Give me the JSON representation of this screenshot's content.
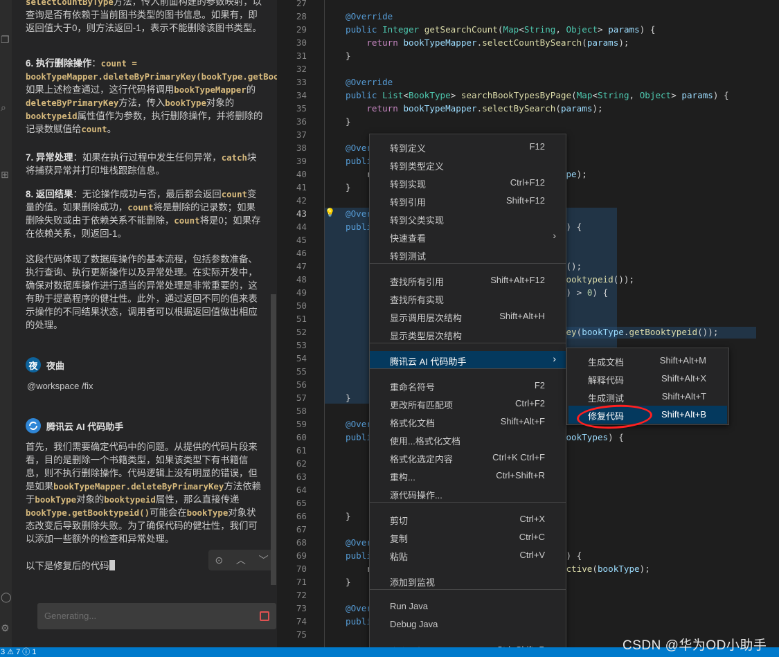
{
  "status_bar": {
    "text": "3 ⚠ 7 ⓘ 1"
  },
  "chat": {
    "paragraphs": [
      {
        "id": "p0",
        "html": "<span class=\"c\">selectCountByType</span>方法，传入前面构建的参数映射，以查询是否有依赖于当前图书类型的图书信息。如果有，即返回值大于0，则方法返回-1，表示不能删除该图书类型。"
      },
      {
        "id": "p1",
        "html": "<b>6. 执行删除操作</b>：<span class=\"c\">count = bookTypeMapper.deleteByPrimaryKey(bookType.getBooktypeid());</span>。如果上述检查通过，这行代码将调用<span class=\"c\">bookTypeMapper</span>的<span class=\"c\">deleteByPrimaryKey</span>方法，传入<span class=\"c\">bookType</span>对象的<span class=\"c\">booktypeid</span>属性值作为参数，执行删除操作，并将删除的记录数赋值给<span class=\"c\">count</span>。"
      },
      {
        "id": "p2",
        "html": "<b>7. 异常处理</b>：如果在执行过程中发生任何异常，<span class=\"c\">catch</span>块将捕获异常并打印堆栈跟踪信息。"
      },
      {
        "id": "p3",
        "html": "<b>8. 返回结果</b>：无论操作成功与否，最后都会返回<span class=\"c\">count</span>变量的值。如果删除成功，<span class=\"c\">count</span>将是删除的记录数；如果删除失败或由于依赖关系不能删除，<span class=\"c\">count</span>将是0；如果存在依赖关系，则返回-1。"
      },
      {
        "id": "p4",
        "html": "这段代码体现了数据库操作的基本流程，包括参数准备、执行查询、执行更新操作以及异常处理。在实际开发中，确保对数据库操作进行适当的异常处理是非常重要的，这有助于提高程序的健壮性。此外，通过返回不同的值来表示操作的不同结果状态，调用者可以根据返回值做出相应的处理。"
      },
      {
        "id": "p5",
        "html": "首先，我们需要确定代码中的问题。从提供的代码片段来看，目的是删除一个书籍类型，如果该类型下有书籍信息，则不执行删除操作。代码逻辑上没有明显的错误，但是如果<span class=\"c\">bookTypeMapper.deleteByPrimaryKey</span>方法依赖于<span class=\"c\">bookType</span>对象的<span class=\"c\">booktypeid</span>属性，那么直接传递<span class=\"c\">bookType.getBooktypeid()</span>可能会在<span class=\"c\">bookType</span>对象状态改变后导致删除失败。为了确保代码的健壮性，我们可以添加一些额外的检查和异常处理。"
      }
    ],
    "user": {
      "avatar": "夜",
      "name": "夜曲",
      "command": "@workspace  /fix"
    },
    "assistant": {
      "name": "腾讯云 AI 代码助手",
      "generating_text": "以下是修复后的代码"
    },
    "input": {
      "placeholder": "Generating..."
    }
  },
  "editor": {
    "line_numbers": [
      "27",
      "28",
      "29",
      "30",
      "31",
      "32",
      "33",
      "34",
      "35",
      "36",
      "37",
      "38",
      "39",
      "40",
      "41",
      "42",
      "43",
      "44",
      "45",
      "46",
      "47",
      "48",
      "49",
      "50",
      "51",
      "52",
      "53",
      "54",
      "55",
      "56",
      "57",
      "58",
      "59",
      "60",
      "61",
      "62",
      "63",
      "64",
      "65",
      "66",
      "67",
      "68",
      "69",
      "70",
      "71",
      "72",
      "73",
      "74",
      "75"
    ],
    "current_line": "43"
  },
  "context_menu": {
    "items": [
      {
        "label": "转到定义",
        "key": "F12"
      },
      {
        "label": "转到类型定义",
        "key": ""
      },
      {
        "label": "转到实现",
        "key": "Ctrl+F12"
      },
      {
        "label": "转到引用",
        "key": "Shift+F12"
      },
      {
        "label": "转到父类实现",
        "key": ""
      },
      {
        "label": "快速查看",
        "key": "",
        "submenu": true
      },
      {
        "label": "转到测试",
        "key": ""
      },
      {
        "label": "查找所有引用",
        "key": "Shift+Alt+F12"
      },
      {
        "label": "查找所有实现",
        "key": ""
      },
      {
        "label": "显示调用层次结构",
        "key": "Shift+Alt+H"
      },
      {
        "label": "显示类型层次结构",
        "key": ""
      },
      {
        "label": "腾讯云 AI 代码助手",
        "key": "",
        "submenu": true,
        "highlight": true
      },
      {
        "label": "重命名符号",
        "key": "F2"
      },
      {
        "label": "更改所有匹配项",
        "key": "Ctrl+F2"
      },
      {
        "label": "格式化文档",
        "key": "Shift+Alt+F"
      },
      {
        "label": "使用...格式化文档",
        "key": ""
      },
      {
        "label": "格式化选定内容",
        "key": "Ctrl+K Ctrl+F"
      },
      {
        "label": "重构...",
        "key": "Ctrl+Shift+R"
      },
      {
        "label": "源代码操作...",
        "key": ""
      },
      {
        "label": "剪切",
        "key": "Ctrl+X"
      },
      {
        "label": "复制",
        "key": "Ctrl+C"
      },
      {
        "label": "粘贴",
        "key": "Ctrl+V"
      },
      {
        "label": "添加到监视",
        "key": ""
      },
      {
        "label": "Run Java",
        "key": ""
      },
      {
        "label": "Debug Java",
        "key": ""
      },
      {
        "label": "命令面板...",
        "key": "Ctrl+Shift+P"
      }
    ],
    "submenu": [
      {
        "label": "生成文档",
        "key": "Shift+Alt+M"
      },
      {
        "label": "解释代码",
        "key": "Shift+Alt+X"
      },
      {
        "label": "生成测试",
        "key": "Shift+Alt+T"
      },
      {
        "label": "修复代码",
        "key": "Shift+Alt+B",
        "highlight": true
      }
    ]
  },
  "watermark": "CSDN @华为OD小助手",
  "colors": {
    "accent": "#007acc",
    "menu_highlight": "#04395e",
    "annotation_circle": "#ff2020"
  }
}
